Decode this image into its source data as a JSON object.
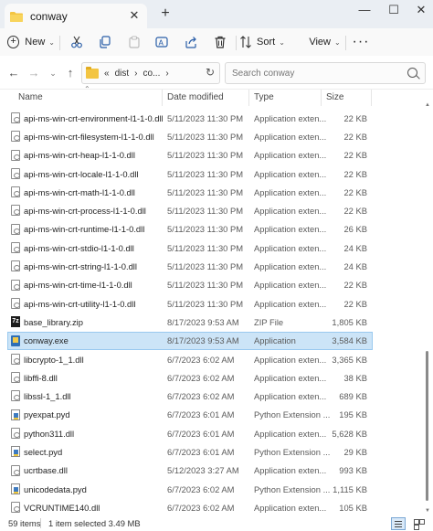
{
  "tab": {
    "title": "conway",
    "close": "✕",
    "add": "+"
  },
  "window": {
    "minimize": "—",
    "maximize": "☐",
    "close": "✕"
  },
  "toolbar": {
    "new_label": "New",
    "sort_label": "Sort",
    "view_label": "View",
    "more_label": "···"
  },
  "address": {
    "overflow": "«",
    "crumbs": [
      "dist",
      "co..."
    ],
    "separator": "›"
  },
  "search": {
    "placeholder": "Search conway"
  },
  "columns": {
    "name": "Name",
    "date": "Date modified",
    "type": "Type",
    "size": "Size"
  },
  "files": [
    {
      "name": "api-ms-win-crt-environment-l1-1-0.dll",
      "date": "5/11/2023 11:30 PM",
      "type": "Application exten...",
      "size": "22 KB",
      "icon": "dll-icon"
    },
    {
      "name": "api-ms-win-crt-filesystem-l1-1-0.dll",
      "date": "5/11/2023 11:30 PM",
      "type": "Application exten...",
      "size": "22 KB",
      "icon": "dll-icon"
    },
    {
      "name": "api-ms-win-crt-heap-l1-1-0.dll",
      "date": "5/11/2023 11:30 PM",
      "type": "Application exten...",
      "size": "22 KB",
      "icon": "dll-icon"
    },
    {
      "name": "api-ms-win-crt-locale-l1-1-0.dll",
      "date": "5/11/2023 11:30 PM",
      "type": "Application exten...",
      "size": "22 KB",
      "icon": "dll-icon"
    },
    {
      "name": "api-ms-win-crt-math-l1-1-0.dll",
      "date": "5/11/2023 11:30 PM",
      "type": "Application exten...",
      "size": "22 KB",
      "icon": "dll-icon"
    },
    {
      "name": "api-ms-win-crt-process-l1-1-0.dll",
      "date": "5/11/2023 11:30 PM",
      "type": "Application exten...",
      "size": "22 KB",
      "icon": "dll-icon"
    },
    {
      "name": "api-ms-win-crt-runtime-l1-1-0.dll",
      "date": "5/11/2023 11:30 PM",
      "type": "Application exten...",
      "size": "26 KB",
      "icon": "dll-icon"
    },
    {
      "name": "api-ms-win-crt-stdio-l1-1-0.dll",
      "date": "5/11/2023 11:30 PM",
      "type": "Application exten...",
      "size": "24 KB",
      "icon": "dll-icon"
    },
    {
      "name": "api-ms-win-crt-string-l1-1-0.dll",
      "date": "5/11/2023 11:30 PM",
      "type": "Application exten...",
      "size": "24 KB",
      "icon": "dll-icon"
    },
    {
      "name": "api-ms-win-crt-time-l1-1-0.dll",
      "date": "5/11/2023 11:30 PM",
      "type": "Application exten...",
      "size": "22 KB",
      "icon": "dll-icon"
    },
    {
      "name": "api-ms-win-crt-utility-l1-1-0.dll",
      "date": "5/11/2023 11:30 PM",
      "type": "Application exten...",
      "size": "22 KB",
      "icon": "dll-icon"
    },
    {
      "name": "base_library.zip",
      "date": "8/17/2023 9:53 AM",
      "type": "ZIP File",
      "size": "1,805 KB",
      "icon": "zip-icon"
    },
    {
      "name": "conway.exe",
      "date": "8/17/2023 9:53 AM",
      "type": "Application",
      "size": "3,584 KB",
      "icon": "exe-icon",
      "selected": true
    },
    {
      "name": "libcrypto-1_1.dll",
      "date": "6/7/2023 6:02 AM",
      "type": "Application exten...",
      "size": "3,365 KB",
      "icon": "dll-icon"
    },
    {
      "name": "libffi-8.dll",
      "date": "6/7/2023 6:02 AM",
      "type": "Application exten...",
      "size": "38 KB",
      "icon": "dll-icon"
    },
    {
      "name": "libssl-1_1.dll",
      "date": "6/7/2023 6:02 AM",
      "type": "Application exten...",
      "size": "689 KB",
      "icon": "dll-icon"
    },
    {
      "name": "pyexpat.pyd",
      "date": "6/7/2023 6:01 AM",
      "type": "Python Extension ...",
      "size": "195 KB",
      "icon": "pyd-icon"
    },
    {
      "name": "python311.dll",
      "date": "6/7/2023 6:01 AM",
      "type": "Application exten...",
      "size": "5,628 KB",
      "icon": "dll-icon"
    },
    {
      "name": "select.pyd",
      "date": "6/7/2023 6:01 AM",
      "type": "Python Extension ...",
      "size": "29 KB",
      "icon": "pyd-icon"
    },
    {
      "name": "ucrtbase.dll",
      "date": "5/12/2023 3:27 AM",
      "type": "Application exten...",
      "size": "993 KB",
      "icon": "dll-icon"
    },
    {
      "name": "unicodedata.pyd",
      "date": "6/7/2023 6:02 AM",
      "type": "Python Extension ...",
      "size": "1,115 KB",
      "icon": "pyd-icon"
    },
    {
      "name": "VCRUNTIME140.dll",
      "date": "6/7/2023 6:02 AM",
      "type": "Application exten...",
      "size": "105 KB",
      "icon": "dll-icon"
    }
  ],
  "status": {
    "count": "59 items",
    "selection": "1 item selected  3.49 MB"
  }
}
